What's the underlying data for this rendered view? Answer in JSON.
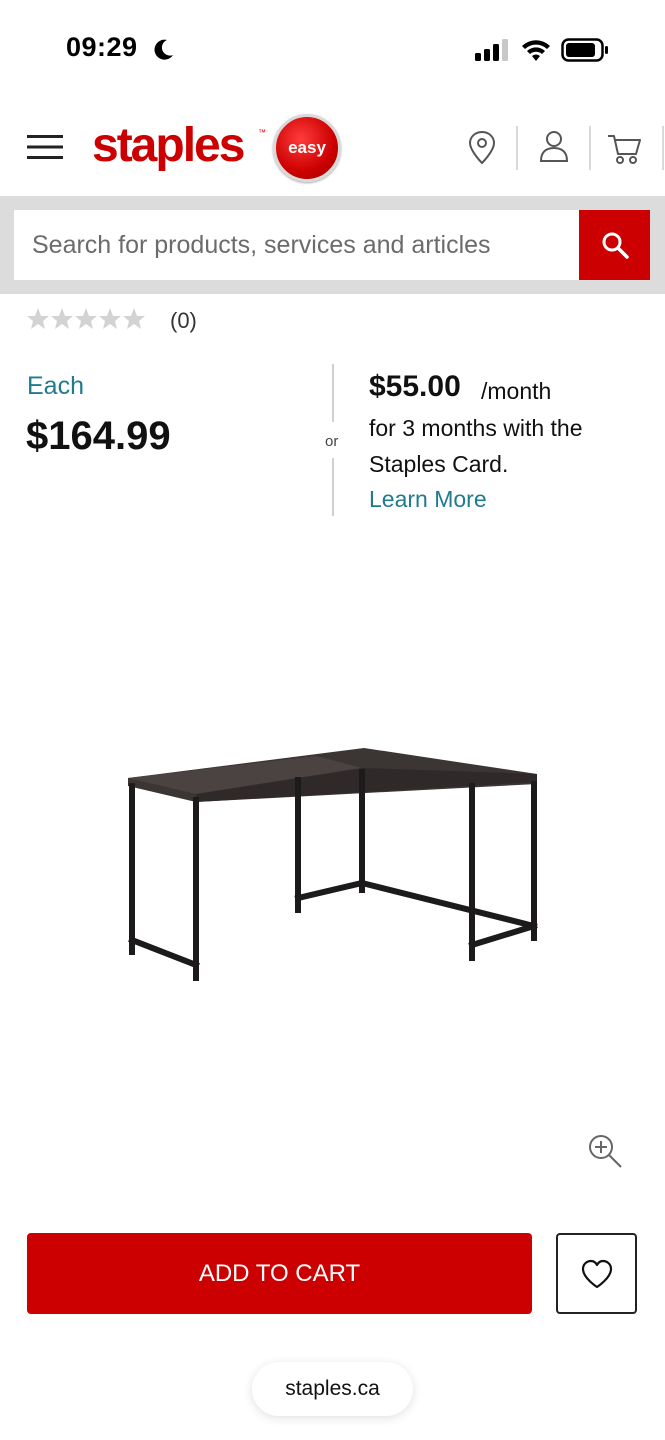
{
  "status_bar": {
    "time": "09:29",
    "icons": [
      "moon-icon",
      "signal-icon",
      "wifi-icon",
      "battery-icon"
    ]
  },
  "header": {
    "logo_text": "staples",
    "logo_tm": "™",
    "badge_text": "easy",
    "icons": [
      "menu-icon",
      "location-pin-icon",
      "account-icon",
      "cart-icon"
    ]
  },
  "search": {
    "placeholder": "Search for products, services and articles",
    "button_icon": "search-icon"
  },
  "rating": {
    "stars": 0,
    "max_stars": 5,
    "count": "(0)"
  },
  "price": {
    "each_label": "Each",
    "amount": "$164.99",
    "or_label": "or",
    "monthly_amount": "$55.00",
    "monthly_unit": "/month",
    "monthly_line1": "for 3 months with the",
    "monthly_line2": "Staples Card.",
    "learn_more": "Learn More"
  },
  "product": {
    "image_icon": "l-shaped-desk-image",
    "zoom_icon": "zoom-in-icon"
  },
  "actions": {
    "add_to_cart": "ADD TO CART",
    "wishlist_icon": "heart-icon"
  },
  "browser": {
    "url": "staples.ca"
  },
  "colors": {
    "brand_red": "#cc0000",
    "link_teal": "#1f7c8c",
    "search_band": "#dcdcdc"
  }
}
